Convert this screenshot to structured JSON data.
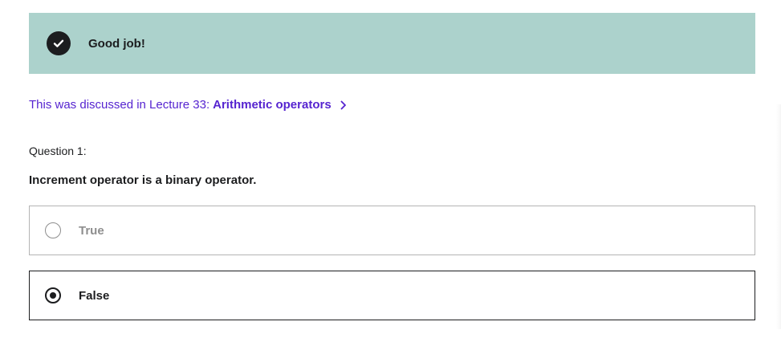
{
  "feedback": {
    "message": "Good job!",
    "icon": "checkmark-circle-icon",
    "background_color": "#acd2cc"
  },
  "lecture_reference": {
    "prefix": "This was discussed in Lecture 33:",
    "lecture_name": "Arithmetic operators",
    "icon": "chevron-right-icon",
    "color": "#5624d0"
  },
  "question": {
    "number_label": "Question 1:",
    "text": "Increment operator is a binary operator."
  },
  "answers": [
    {
      "label": "True",
      "selected": false
    },
    {
      "label": "False",
      "selected": true
    }
  ]
}
